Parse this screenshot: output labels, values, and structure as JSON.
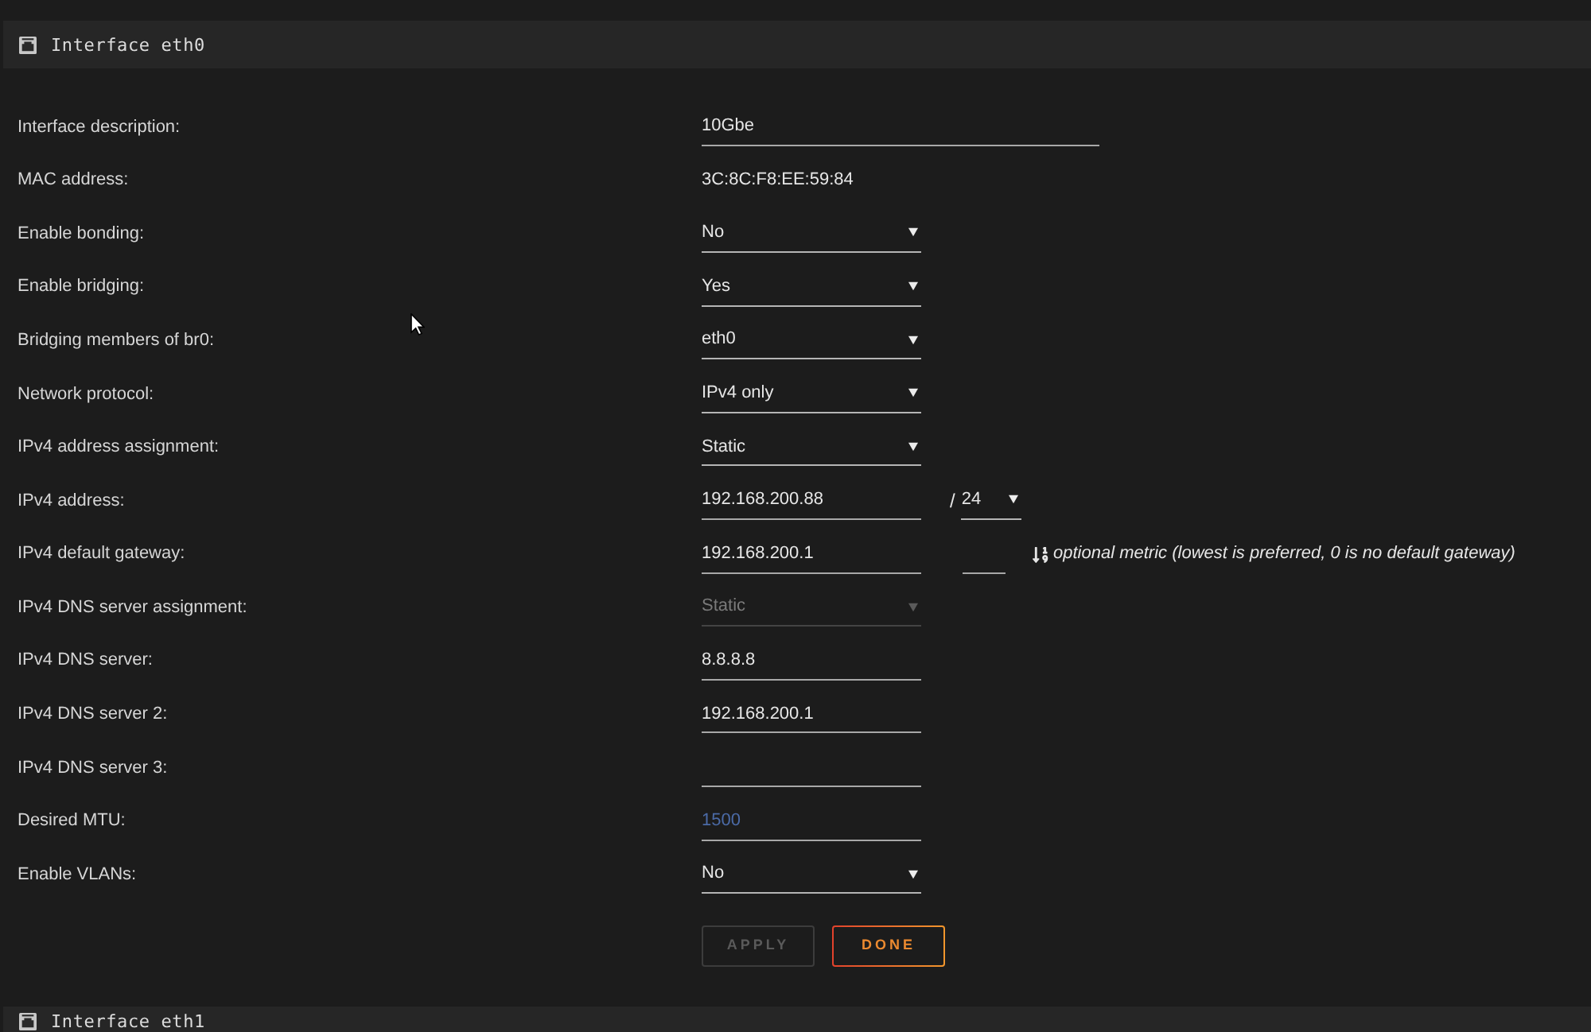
{
  "section": {
    "title": "Interface eth0"
  },
  "fields": [
    {
      "label": "Interface description:",
      "kind": "longtext",
      "value": "10Gbe",
      "disabled": false
    },
    {
      "label": "MAC address:",
      "kind": "readout",
      "value": "3C:8C:F8:EE:59:84"
    },
    {
      "label": "Enable bonding:",
      "kind": "select",
      "value": "No",
      "disabled": false
    },
    {
      "label": "Enable bridging:",
      "kind": "select",
      "value": "Yes",
      "disabled": false
    },
    {
      "label": "Bridging members of br0:",
      "kind": "select",
      "value": "eth0",
      "disabled": false
    },
    {
      "label": "Network protocol:",
      "kind": "select",
      "value": "IPv4 only",
      "disabled": false
    },
    {
      "label": "IPv4 address assignment:",
      "kind": "select",
      "value": "Static",
      "disabled": false
    },
    {
      "label": "IPv4 address:",
      "kind": "address",
      "value": "192.168.200.88",
      "separator": "/",
      "prefix": "24",
      "disabled": false
    },
    {
      "label": "IPv4 default gateway:",
      "kind": "gateway",
      "value": "192.168.200.1",
      "metric_note": "optional metric (lowest is preferred, 0 is no default gateway)",
      "disabled": false
    },
    {
      "label": "IPv4 DNS server assignment:",
      "kind": "select",
      "value": "Static",
      "disabled": true
    },
    {
      "label": "IPv4 DNS server:",
      "kind": "text",
      "value": "8.8.8.8",
      "disabled": false
    },
    {
      "label": "IPv4 DNS server 2:",
      "kind": "text",
      "value": "192.168.200.1",
      "disabled": false
    },
    {
      "label": "IPv4 DNS server 3:",
      "kind": "text",
      "disabled": false
    },
    {
      "label": "Desired MTU:",
      "kind": "text",
      "placeholder": "1500",
      "disabled": false
    },
    {
      "label": "Enable VLANs:",
      "kind": "select",
      "value": "No",
      "disabled": false
    }
  ],
  "buttons": [
    {
      "label": "APPLY",
      "disabled": true
    },
    {
      "label": "DONE",
      "disabled": false
    }
  ],
  "next_section": {
    "title": "Interface eth1"
  }
}
